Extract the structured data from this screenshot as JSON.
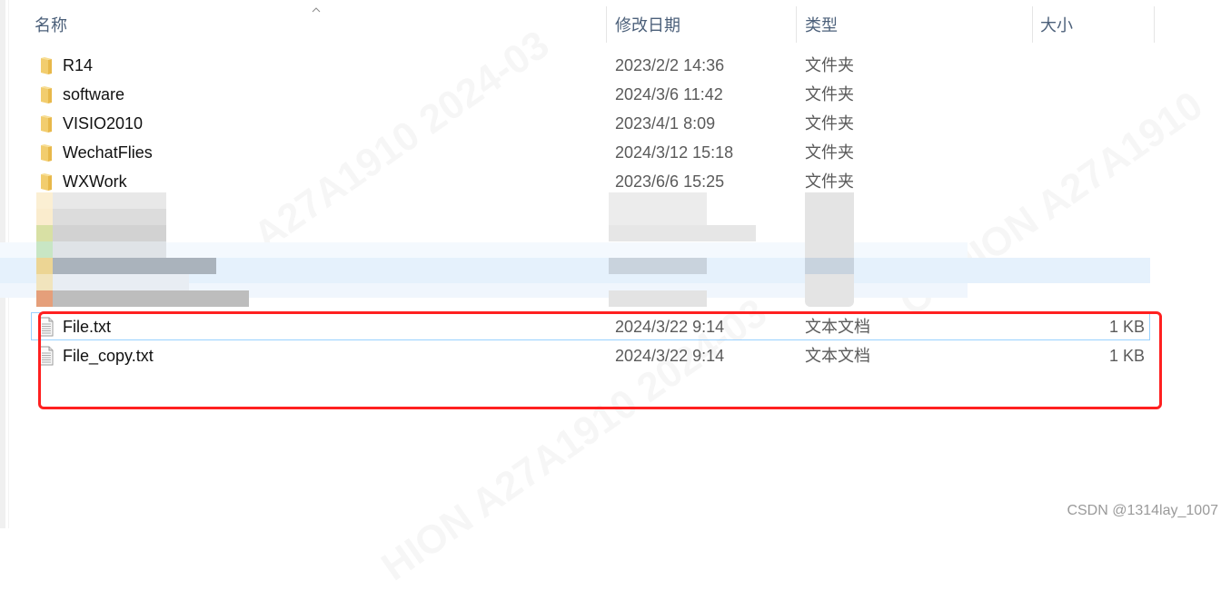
{
  "columns": {
    "name": "名称",
    "modified": "修改日期",
    "type": "类型",
    "size": "大小",
    "sort_indicator": "ascending"
  },
  "rows": [
    {
      "name": "R14",
      "modified": "2023/2/2 14:36",
      "type": "文件夹",
      "size": "",
      "icon": "folder-icon"
    },
    {
      "name": "software",
      "modified": "2024/3/6 11:42",
      "type": "文件夹",
      "size": "",
      "icon": "folder-icon"
    },
    {
      "name": "VISIO2010",
      "modified": "2023/4/1 8:09",
      "type": "文件夹",
      "size": "",
      "icon": "folder-icon"
    },
    {
      "name": "WechatFlies",
      "modified": "2024/3/12 15:18",
      "type": "文件夹",
      "size": "",
      "icon": "folder-icon"
    },
    {
      "name": "WXWork",
      "modified": "2023/6/6 15:25",
      "type": "文件夹",
      "size": "",
      "icon": "folder-icon"
    }
  ],
  "files": [
    {
      "name": "File.txt",
      "modified": "2024/3/22 9:14",
      "type": "文本文档",
      "size": "1 KB",
      "icon": "text-file-icon"
    },
    {
      "name": "File_copy.txt",
      "modified": "2024/3/22 9:14",
      "type": "文本文档",
      "size": "1 KB",
      "icon": "text-file-icon"
    }
  ],
  "watermark": {
    "text_a": "A27A1910  2024-03",
    "text_b": "OSHION  A27A1910",
    "text_c": "HION  A27A1910  2024-03"
  },
  "credit": "CSDN @1314lay_1007",
  "colors": {
    "annotation": "#ff2020",
    "header_text": "#4c607a",
    "selection": "#e5f3ff",
    "focus_border": "#99d1ff"
  }
}
